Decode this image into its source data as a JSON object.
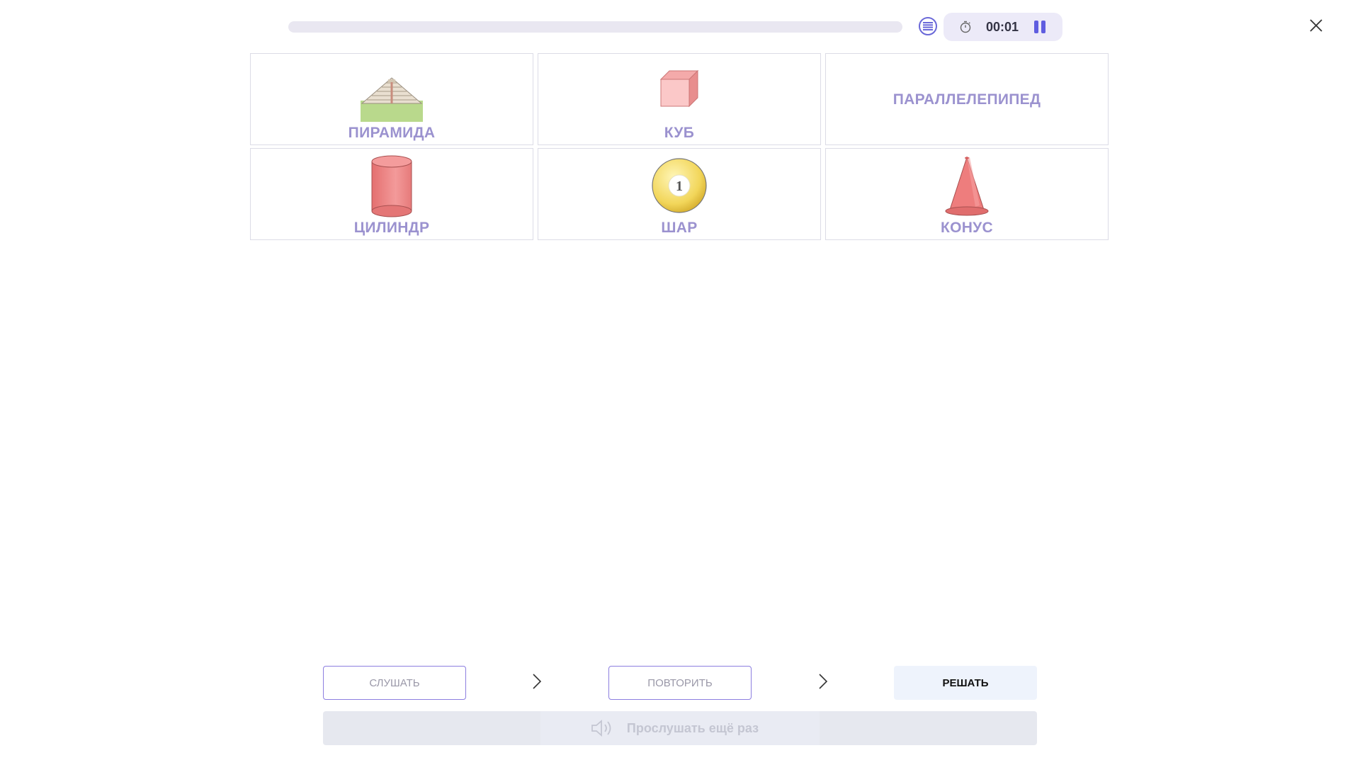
{
  "topbar": {
    "progress_fraction": 0,
    "list_icon": "list-icon",
    "timer_icon": "stopwatch-icon",
    "timer": "00:01",
    "pause_icon": "pause-icon",
    "close_icon": "close-icon"
  },
  "cards": [
    {
      "label": "ПИРАМИДА",
      "icon": "pyramid-image"
    },
    {
      "label": "КУБ",
      "icon": "cube-image"
    },
    {
      "label": "ПАРАЛЛЕЛЕПИПЕД",
      "icon": ""
    },
    {
      "label": "ЦИЛИНДР",
      "icon": "cylinder-image"
    },
    {
      "label": "ШАР",
      "icon": "ball-image"
    },
    {
      "label": "КОНУС",
      "icon": "cone-image"
    }
  ],
  "ball_number": "1",
  "steps": {
    "listen": "СЛУШАТЬ",
    "repeat": "ПОВТОРИТЬ",
    "solve": "РЕШАТЬ"
  },
  "listen_again": "Прослушать ещё раз",
  "colors": {
    "accent": "#6a68d8",
    "label": "#9b92cf",
    "card_border": "#dcdce6"
  }
}
